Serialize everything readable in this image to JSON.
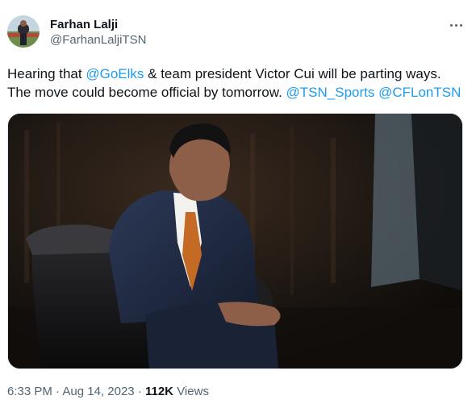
{
  "author": {
    "name": "Farhan Lalji",
    "handle": "@FarhanLaljiTSN"
  },
  "tweet": {
    "line1": {
      "pre": "Hearing that ",
      "mention": "@GoElks",
      "post": " & team president Victor Cui will be parting ways."
    },
    "line2": {
      "pre": "The move could become official by tomorrow. ",
      "mention1": "@TSN_Sports",
      "sep": " ",
      "mention2": "@CFLonTSN"
    }
  },
  "meta": {
    "time": "6:33 PM",
    "dot1": " · ",
    "date": "Aug 14, 2023",
    "dot2": " · ",
    "views_count": "112K",
    "views_label": " Views"
  },
  "colors": {
    "link": "#1d9bf0",
    "secondary_text": "#536471",
    "primary_text": "#0f1419"
  },
  "icons": {
    "more": "more-horizontal-icon"
  }
}
